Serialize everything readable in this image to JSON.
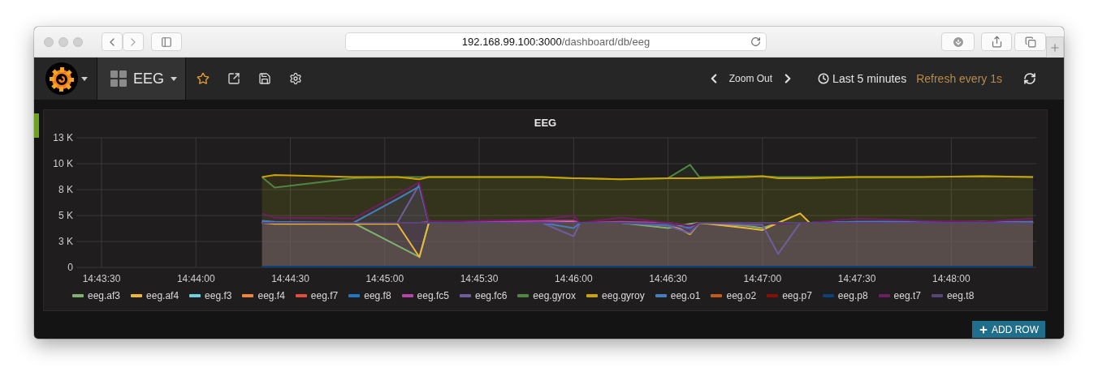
{
  "browser": {
    "url_host": "192.168.99.100:3000",
    "url_path": "/dashboard/db/eeg"
  },
  "navbar": {
    "dashboard_title": "EEG",
    "zoom_out": "Zoom Out",
    "time_range": "Last 5 minutes",
    "refresh": "Refresh every 1s"
  },
  "panel": {
    "chart_data": {
      "type": "area",
      "title": "EEG",
      "grid": true,
      "legend": "bottom",
      "x": [
        53061,
        53065,
        53090,
        53104,
        53111,
        53114,
        53130,
        53150,
        53160,
        53162,
        53175,
        53190,
        53197,
        53200,
        53215,
        53220,
        53225,
        53232,
        53235,
        53250,
        53270,
        53290,
        53306
      ],
      "xlim": [
        53002,
        53307
      ],
      "ylim": [
        0,
        12500
      ],
      "xticks": [
        {
          "value": 53010,
          "label": "14:43:30"
        },
        {
          "value": 53040,
          "label": "14:44:00"
        },
        {
          "value": 53070,
          "label": "14:44:30"
        },
        {
          "value": 53100,
          "label": "14:45:00"
        },
        {
          "value": 53130,
          "label": "14:45:30"
        },
        {
          "value": 53160,
          "label": "14:46:00"
        },
        {
          "value": 53190,
          "label": "14:46:30"
        },
        {
          "value": 53220,
          "label": "14:47:00"
        },
        {
          "value": 53250,
          "label": "14:47:30"
        },
        {
          "value": 53280,
          "label": "14:48:00"
        }
      ],
      "yticks": [
        {
          "value": 0,
          "label": "0"
        },
        {
          "value": 2500,
          "label": "3 K"
        },
        {
          "value": 5000,
          "label": "5 K"
        },
        {
          "value": 7500,
          "label": "8 K"
        },
        {
          "value": 10000,
          "label": "10 K"
        },
        {
          "value": 12500,
          "label": "13 K"
        }
      ],
      "series": [
        {
          "name": "eeg.af3",
          "color": "#7eb26d",
          "values": [
            4300,
            4300,
            4300,
            2100,
            1000,
            4300,
            4300,
            4300,
            4300,
            4300,
            4300,
            3800,
            4200,
            4300,
            4000,
            3800,
            4300,
            4300,
            4300,
            4300,
            4300,
            4400,
            4300
          ]
        },
        {
          "name": "eeg.af4",
          "color": "#eab839",
          "values": [
            4300,
            4200,
            4200,
            4200,
            1000,
            4300,
            4300,
            4300,
            4400,
            4300,
            4300,
            4300,
            3200,
            4300,
            3800,
            3600,
            4300,
            5200,
            4300,
            4300,
            4300,
            4300,
            4300
          ]
        },
        {
          "name": "eeg.f3",
          "color": "#6ed0e0",
          "values": [
            null,
            null,
            null,
            null,
            null,
            null,
            null,
            null,
            null,
            null,
            null,
            null,
            null,
            null,
            null,
            null,
            null,
            null,
            null,
            null,
            null,
            null,
            null
          ]
        },
        {
          "name": "eeg.f4",
          "color": "#ef843c",
          "values": [
            null,
            null,
            null,
            null,
            null,
            null,
            null,
            null,
            null,
            null,
            null,
            null,
            null,
            null,
            null,
            null,
            null,
            null,
            null,
            null,
            null,
            null,
            null
          ]
        },
        {
          "name": "eeg.f7",
          "color": "#e24d42",
          "values": [
            null,
            null,
            null,
            null,
            null,
            null,
            null,
            null,
            null,
            null,
            null,
            null,
            null,
            null,
            null,
            null,
            null,
            null,
            null,
            null,
            null,
            null,
            null
          ]
        },
        {
          "name": "eeg.f8",
          "color": "#1f78c1",
          "values": [
            null,
            null,
            null,
            null,
            null,
            null,
            null,
            null,
            null,
            null,
            null,
            null,
            null,
            null,
            null,
            null,
            null,
            null,
            null,
            null,
            null,
            null,
            null
          ]
        },
        {
          "name": "eeg.fc5",
          "color": "#ba43a9",
          "values": [
            4400,
            4300,
            4300,
            4300,
            4300,
            4400,
            4400,
            4500,
            4500,
            4300,
            4400,
            4300,
            4000,
            4300,
            4300,
            4300,
            4300,
            4300,
            4300,
            4400,
            4400,
            4400,
            4400
          ]
        },
        {
          "name": "eeg.fc6",
          "color": "#705da0",
          "values": [
            4400,
            4300,
            4300,
            4300,
            8000,
            4300,
            4300,
            4300,
            3000,
            4300,
            4300,
            4000,
            3300,
            4300,
            4100,
            4100,
            1300,
            4300,
            4300,
            4300,
            4300,
            4400,
            4300
          ]
        },
        {
          "name": "eeg.gyrox",
          "color": "#508642",
          "values": [
            8700,
            7700,
            8600,
            8700,
            8700,
            8700,
            8700,
            8700,
            8600,
            8600,
            8500,
            8600,
            9900,
            8700,
            8800,
            8800,
            8700,
            8700,
            8700,
            8700,
            8700,
            8800,
            8700
          ]
        },
        {
          "name": "eeg.gyroy",
          "color": "#cca300",
          "values": [
            8700,
            8900,
            8700,
            8700,
            8500,
            8700,
            8700,
            8700,
            8600,
            8600,
            8500,
            8600,
            8600,
            8600,
            8700,
            8800,
            8600,
            8600,
            8600,
            8700,
            8700,
            8800,
            8700
          ]
        },
        {
          "name": "eeg.o1",
          "color": "#447ebc",
          "values": [
            4500,
            4400,
            4300,
            6600,
            7800,
            4300,
            4300,
            4300,
            3800,
            4300,
            4300,
            4100,
            3800,
            4300,
            4300,
            4300,
            4300,
            4300,
            4300,
            4400,
            4400,
            4300,
            4400
          ]
        },
        {
          "name": "eeg.o2",
          "color": "#c15c17",
          "values": [
            null,
            null,
            null,
            null,
            null,
            null,
            null,
            null,
            null,
            null,
            null,
            null,
            null,
            null,
            null,
            null,
            null,
            null,
            null,
            null,
            null,
            null,
            null
          ]
        },
        {
          "name": "eeg.p7",
          "color": "#890f02",
          "values": [
            null,
            null,
            null,
            null,
            null,
            null,
            null,
            null,
            null,
            null,
            null,
            null,
            null,
            null,
            null,
            null,
            null,
            null,
            null,
            null,
            null,
            null,
            null
          ]
        },
        {
          "name": "eeg.p8",
          "color": "#0a437c",
          "values": [
            80,
            80,
            80,
            80,
            80,
            80,
            80,
            80,
            80,
            80,
            80,
            80,
            80,
            80,
            80,
            80,
            80,
            80,
            80,
            80,
            80,
            80,
            80
          ]
        },
        {
          "name": "eeg.t7",
          "color": "#6d1f62",
          "values": [
            5200,
            4800,
            4700,
            7000,
            8200,
            4400,
            4500,
            4600,
            5000,
            4300,
            4800,
            4300,
            4000,
            4300,
            4300,
            4300,
            4200,
            4300,
            4300,
            4700,
            4500,
            4400,
            4700
          ]
        },
        {
          "name": "eeg.t8",
          "color": "#584477",
          "values": [
            4300,
            4300,
            4300,
            4300,
            4300,
            4300,
            4300,
            4300,
            4300,
            4300,
            4300,
            4200,
            3600,
            4300,
            4300,
            4300,
            4300,
            4300,
            4300,
            4300,
            4300,
            4300,
            4250
          ]
        }
      ]
    }
  },
  "add_row_button": "ADD ROW"
}
